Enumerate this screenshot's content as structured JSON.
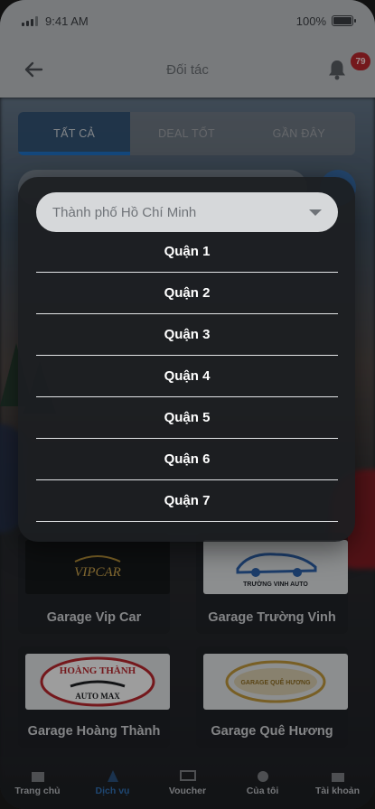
{
  "status_bar": {
    "time": "9:41 AM",
    "battery": "100%"
  },
  "header": {
    "title": "Đối tác",
    "notification_count": "79"
  },
  "tabs": [
    {
      "label": "TẤT CẢ",
      "active": true
    },
    {
      "label": "DEAL TỐT",
      "active": false
    },
    {
      "label": "GẦN ĐÂY",
      "active": false
    }
  ],
  "garages": [
    {
      "name": "Garage Vip Car",
      "logo_text": "VIPCAR"
    },
    {
      "name": "Garage Trường Vinh",
      "logo_text": "TRƯỜNG VINH AUTO"
    },
    {
      "name": "Garage Hoàng Thành",
      "logo_text": "HOÀNG THÀNH",
      "logo_subtext": "AUTO MAX"
    },
    {
      "name": "Garage Quê Hương",
      "logo_text": "GARAGE QUÊ HƯƠNG"
    }
  ],
  "bottom_nav": [
    {
      "label": "Trang chủ",
      "active": false
    },
    {
      "label": "Dịch vụ",
      "active": true
    },
    {
      "label": "Voucher",
      "active": false
    },
    {
      "label": "Của tôi",
      "active": false
    },
    {
      "label": "Tài khoản",
      "active": false
    }
  ],
  "dropdown": {
    "selected_city": "Thành phố Hồ Chí Minh",
    "districts": [
      "Quận 1",
      "Quận 2",
      "Quận 3",
      "Quận 4",
      "Quận 5",
      "Quận 6",
      "Quận 7"
    ]
  },
  "colors": {
    "accent": "#1f6fc0",
    "badge": "#b3262c",
    "panel": "#1c1e21"
  }
}
